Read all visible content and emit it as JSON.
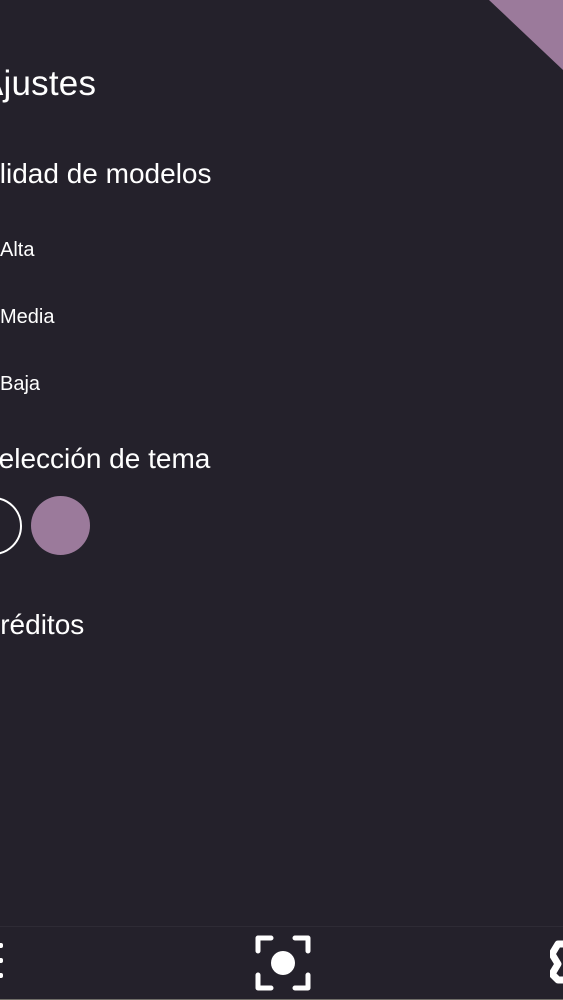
{
  "header": {
    "title": "Ajustes"
  },
  "quality": {
    "title": "Calidad de modelos",
    "options": [
      "Alta",
      "Media",
      "Baja"
    ]
  },
  "theme": {
    "title": "Selección de tema",
    "options": [
      "light-theme",
      "purple-theme"
    ]
  },
  "credits": {
    "title": "Créditos"
  },
  "bottom_nav": {
    "items": [
      "menu-icon",
      "camera-icon",
      "settings-icon"
    ]
  },
  "colors": {
    "background": "#24212b",
    "accent": "#9b7a9b",
    "text": "#ffffff",
    "bottom_line": "#706e68"
  }
}
